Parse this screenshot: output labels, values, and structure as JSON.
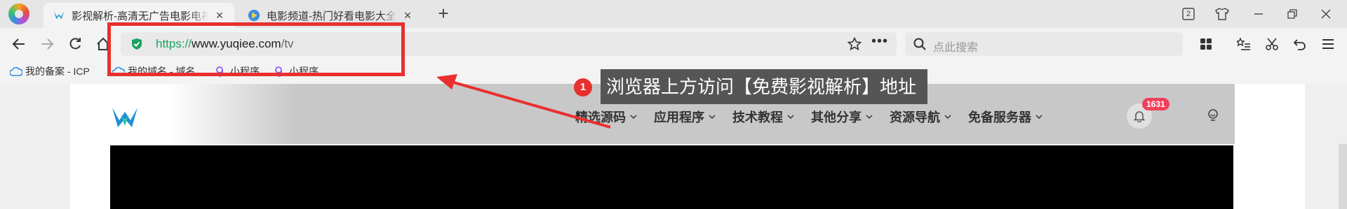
{
  "browser": {
    "tabs": [
      {
        "label": "影视解析-高清无广告电影电视",
        "active": true,
        "icon": "site-bird-icon"
      },
      {
        "label": "电影频道-热门好看电影大全",
        "active": false,
        "icon": "video-play-icon"
      }
    ],
    "tab_count_label": "2",
    "address": {
      "protocol": "https://",
      "host": "www.yuqiee.com",
      "path": "/tv"
    },
    "search_placeholder": "点此搜索",
    "bookmarks": [
      {
        "label": "我的备案 - ICP",
        "icon": "cloud-icon"
      },
      {
        "label": "我的域名 - 域名",
        "icon": "cloud-icon"
      },
      {
        "label": "小程序",
        "icon": "miniprogram-icon"
      },
      {
        "label": "小程序",
        "icon": "miniprogram-icon"
      }
    ]
  },
  "site": {
    "nav": [
      {
        "label": "精选源码"
      },
      {
        "label": "应用程序"
      },
      {
        "label": "技术教程"
      },
      {
        "label": "其他分享"
      },
      {
        "label": "资源导航"
      },
      {
        "label": "免备服务器"
      }
    ],
    "notification_count": "1631"
  },
  "annotation": {
    "step_number": "1",
    "text": "浏览器上方访问【免费影视解析】地址"
  },
  "colors": {
    "highlight": "#e8302f",
    "secure": "#1aa260",
    "badge": "#f0405a",
    "callout_bg": "#555555"
  }
}
